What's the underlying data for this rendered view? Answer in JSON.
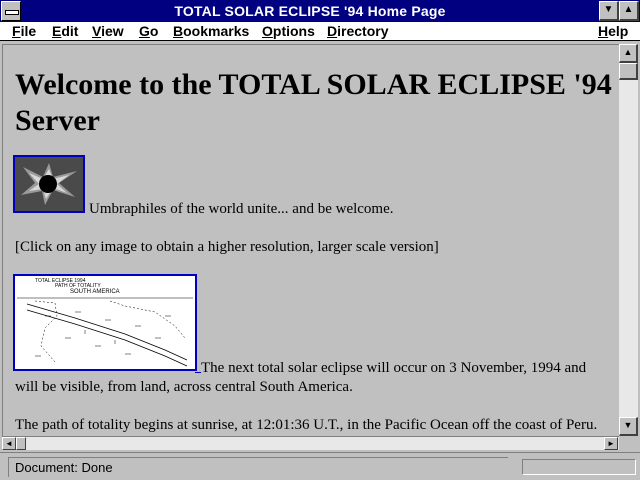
{
  "window": {
    "title": "TOTAL SOLAR ECLIPSE '94 Home Page",
    "minimize_glyph": "▼",
    "maximize_glyph": "▲"
  },
  "menu": {
    "items": [
      {
        "label": "File",
        "underline": "F",
        "rest": "ile"
      },
      {
        "label": "Edit",
        "underline": "E",
        "rest": "dit"
      },
      {
        "label": "View",
        "underline": "V",
        "rest": "iew"
      },
      {
        "label": "Go",
        "underline": "G",
        "rest": "o"
      },
      {
        "label": "Bookmarks",
        "underline": "B",
        "rest": "ookmarks"
      },
      {
        "label": "Options",
        "underline": "O",
        "rest": "ptions"
      },
      {
        "label": "Directory",
        "underline": "D",
        "rest": "irectory"
      },
      {
        "label": "Help",
        "underline": "H",
        "rest": "elp"
      }
    ]
  },
  "page": {
    "heading": "Welcome to the TOTAL SOLAR ECLIPSE '94 Server",
    "intro": "Umbraphiles of the world unite... and be welcome.",
    "click_note": "[Click on any image to obtain a higher resolution, larger scale version]",
    "next_eclipse": "The next total solar eclipse will occur on 3 November, 1994 and will be visible, from land, across central South America.",
    "path_text": "The path of totality begins at sunrise, at 12:01:36 U.T., in the Pacific Ocean off the coast of Peru."
  },
  "images": {
    "corona": {
      "icon": "eclipse-corona-image"
    },
    "map": {
      "icon": "eclipse-path-map-image",
      "caption_line1": "TOTAL ECLIPSE 1994",
      "caption_line2": "PATH OF TOTALITY",
      "caption_line3": "SOUTH AMERICA"
    }
  },
  "scrollbars": {
    "up_glyph": "▲",
    "down_glyph": "▼",
    "left_glyph": "◄",
    "right_glyph": "►"
  },
  "status": {
    "text": "Document: Done",
    "progress": 0
  }
}
